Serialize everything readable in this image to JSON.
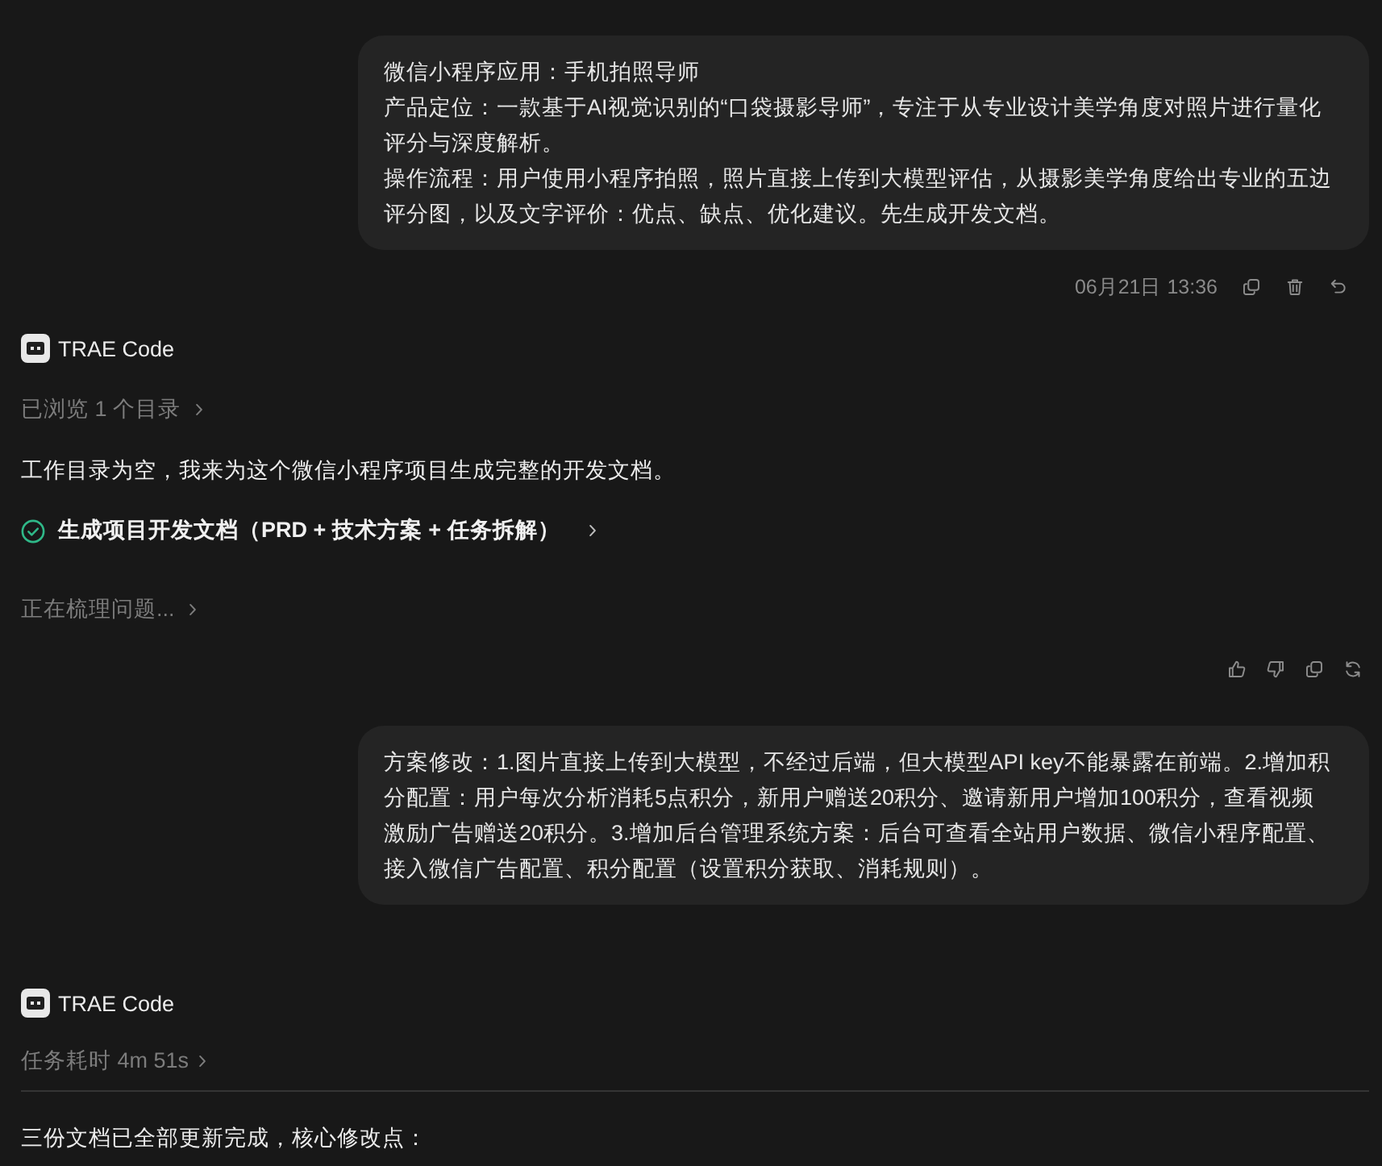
{
  "messages": [
    {
      "kind": "user",
      "paragraphs": [
        "微信小程序应用：手机拍照导师",
        "产品定位：一款基于AI视觉识别的“口袋摄影导师”，专注于从专业设计美学角度对照片进行量化评分与深度解析。",
        "操作流程：用户使用小程序拍照，照片直接上传到大模型评估，从摄影美学角度给出专业的五边评分图，以及文字评价：优点、缺点、优化建议。先生成开发文档。"
      ],
      "time": "06月21日 13:36"
    },
    {
      "kind": "assistant",
      "author": "TRAE Code",
      "steps": [
        {
          "kind": "collapsed",
          "text": "已浏览 1 个目录"
        },
        {
          "kind": "text",
          "text": "工作目录为空，我来为这个微信小程序项目生成完整的开发文档。"
        },
        {
          "kind": "task",
          "text": "生成项目开发文档（PRD + 技术方案 + 任务拆解）",
          "done": true
        },
        {
          "kind": "collapsed",
          "text": "正在梳理问题..."
        },
        {
          "kind": "feedback"
        }
      ]
    },
    {
      "kind": "user",
      "paragraphs": [
        "方案修改：1.图片直接上传到大模型，不经过后端，但大模型API key不能暴露在前端。2.增加积分配置：用户每次分析消耗5点积分，新用户赠送20积分、邀请新用户增加100积分，查看视频激励广告赠送20积分。3.增加后台管理系统方案：后台可查看全站用户数据、微信小程序配置、接入微信广告配置、积分配置（设置积分获取、消耗规则）。"
      ]
    },
    {
      "kind": "assistant",
      "author": "TRAE Code",
      "steps": [
        {
          "kind": "summary",
          "text": "任务耗时 4m 51s"
        },
        {
          "kind": "text",
          "text": "三份文档已全部更新完成，核心修改点："
        }
      ]
    }
  ]
}
